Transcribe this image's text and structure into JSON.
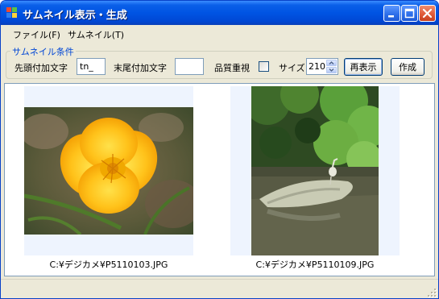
{
  "window": {
    "title": "サムネイル表示・生成",
    "icon": "app-window-icon",
    "controls": [
      "minimize-icon",
      "maximize-icon",
      "close-icon"
    ],
    "accent": "#0054e3"
  },
  "menubar": {
    "items": [
      {
        "label": "ファイル(F)"
      },
      {
        "label": "サムネイル(T)"
      }
    ]
  },
  "options": {
    "group_title": "サムネイル条件",
    "prefix_label": "先頭付加文字",
    "prefix_value": "tn_",
    "suffix_label": "末尾付加文字",
    "suffix_value": "",
    "quality_label": "品質重視",
    "quality_checked": false,
    "size_label": "サイズ",
    "size_value": "210",
    "redisplay_button": "再表示",
    "create_button": "作成"
  },
  "thumbnails": [
    {
      "caption": "C:¥デジカメ¥P5110103.JPG",
      "subject": "yellow-poppy-flower"
    },
    {
      "caption": "C:¥デジカメ¥P5110109.JPG",
      "subject": "heron-on-rock-in-river"
    }
  ]
}
